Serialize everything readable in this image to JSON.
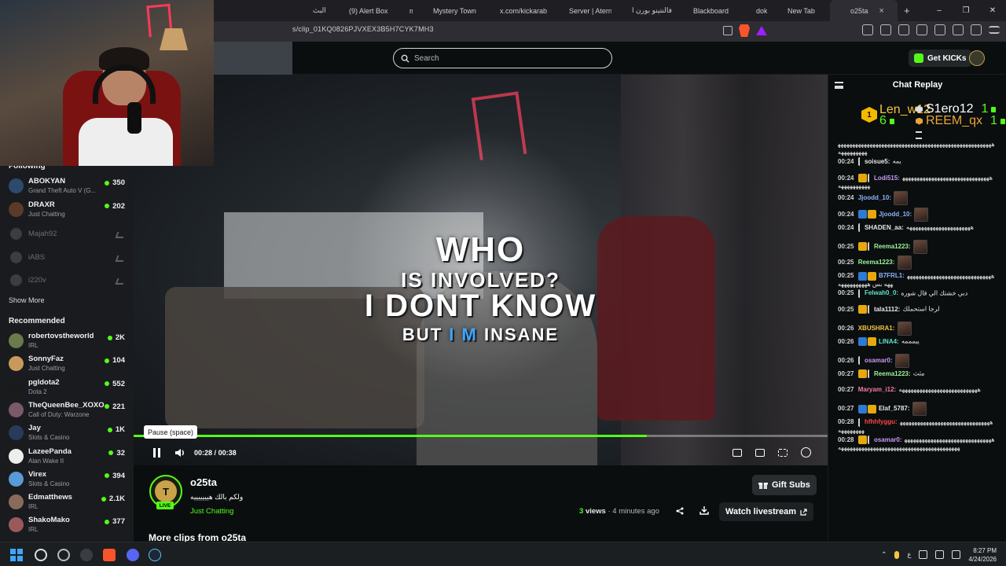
{
  "browser": {
    "tabs": [
      {
        "label": "البث",
        "color": "#555555"
      },
      {
        "label": "(9) Alert Box /",
        "color": "#3fbf9f"
      },
      {
        "label": "mt",
        "color": "#8a5a44"
      },
      {
        "label": "Mystery Town",
        "color": "#c0392b"
      },
      {
        "label": "x.com/kickarab",
        "color": "#111111"
      },
      {
        "label": "Server | Aterno",
        "color": "#2f6fd6"
      },
      {
        "label": "فالنتينو بورن ا",
        "color": "#f2f2f2"
      },
      {
        "label": "Blackboard",
        "color": "#f4b400"
      },
      {
        "label": "dokan",
        "color": "#b58a3c"
      },
      {
        "label": "New Tab",
        "color": "#dddddd"
      },
      {
        "label": "o25ta",
        "color": "#53fc18"
      }
    ],
    "url": "s/clip_01KQ0826PJVXEX3B5H7CYK7MH3",
    "window_controls": [
      "–",
      "❐",
      "✕"
    ],
    "new_tab": "+"
  },
  "header": {
    "search_placeholder": "Search",
    "get_kicks_label": "Get KICKs"
  },
  "sidebar": {
    "following_heading": "Following",
    "following": [
      {
        "name": "ABOKYAN",
        "sub": "Grand Theft Auto V (G...",
        "count": "350",
        "live": true,
        "avatar": "#2c4a6e"
      },
      {
        "name": "DRAXR",
        "sub": "Just Chatting",
        "count": "202",
        "live": true,
        "avatar": "#5a3b2a"
      },
      {
        "name": "Majah92",
        "sub": "",
        "count": "",
        "live": false,
        "avatar": "#3a3d41"
      },
      {
        "name": "iABS",
        "sub": "",
        "count": "",
        "live": false,
        "avatar": "#3a3d41"
      },
      {
        "name": "i220v",
        "sub": "",
        "count": "",
        "live": false,
        "avatar": "#3a3d41"
      }
    ],
    "show_more_label": "Show More",
    "recommended_heading": "Recommended",
    "recommended": [
      {
        "name": "robertovstheworld",
        "sub": "IRL",
        "count": "2K",
        "avatar": "#6a7a4a"
      },
      {
        "name": "SonnyFaz",
        "sub": "Just Chatting",
        "count": "104",
        "avatar": "#c89a5a"
      },
      {
        "name": "pgldota2",
        "sub": "Dota 2",
        "count": "552",
        "avatar": "#1a1a1a"
      },
      {
        "name": "TheQueenBee_XOXO",
        "sub": "Call of Duty: Warzone",
        "count": "221",
        "avatar": "#7a5a6a"
      },
      {
        "name": "Jay",
        "sub": "Slots & Casino",
        "count": "1K",
        "avatar": "#2a3a5a"
      },
      {
        "name": "LazeePanda",
        "sub": "Alan Wake II",
        "count": "32",
        "avatar": "#ededed"
      },
      {
        "name": "Virex",
        "sub": "Slots & Casino",
        "count": "394",
        "avatar": "#5a9ad6"
      },
      {
        "name": "Edmatthews",
        "sub": "IRL",
        "count": "2.1K",
        "avatar": "#8a6a5a"
      },
      {
        "name": "ShakoMako",
        "sub": "IRL",
        "count": "377",
        "avatar": "#9a5a5a"
      }
    ]
  },
  "video": {
    "caption_line1": "WHO",
    "caption_line2": "IS INVOLVED?",
    "caption_line3": "I DONT KNOW",
    "caption_line4_a": "BUT",
    "caption_line4_b": "I M",
    "caption_line4_c": "INSANE",
    "tooltip": "Pause (space)",
    "time_current": "00:28",
    "time_separator": "/",
    "time_total": "00:38",
    "progress_fraction": 0.74
  },
  "channel": {
    "avatar_letter": "T",
    "live_badge": "LIVE",
    "name": "o25ta",
    "title": "ولكم بالك هيييييييه",
    "category": "Just Chatting",
    "gift_subs_label": "Gift Subs",
    "views_count": "3",
    "views_label": "views",
    "views_time": "· 4 minutes ago",
    "watch_label": "Watch livestream",
    "more_clips_label": "More clips from o25ta"
  },
  "chat": {
    "title": "Chat Replay",
    "leaderboard": {
      "rank": "1",
      "first_name": "Len_w12",
      "first_count": "6",
      "second_name": "S1ero12",
      "second_count": "1",
      "third_name": "REEM_qx",
      "third_count": "1"
    },
    "messages": [
      {
        "time": "",
        "user": "",
        "color": "#e8e8e8",
        "text": "هههههههههههههههههههههههههههههههههههههههههههههههههههههههههههههههه"
      },
      {
        "time": "00:24",
        "user": "soisue5:",
        "color": "#e8e8e8",
        "text": "يمه"
      },
      {
        "time": "00:24",
        "user": "Lodi515:",
        "color": "#c79af5",
        "text": "هههههههههههههههههههههههههههههههههههههههههه"
      },
      {
        "time": "00:24",
        "user": "Jjoodd_10:",
        "color": "#8ab4f8",
        "text": ""
      },
      {
        "time": "00:24",
        "user": "Jjoodd_10:",
        "color": "#8ab4f8",
        "text": ""
      },
      {
        "time": "00:24",
        "user": "SHADEN_aa:",
        "color": "#e8e8e8",
        "text": "ههههههههههههههههههههههه"
      },
      {
        "time": "00:25",
        "user": "Reema1223:",
        "color": "#9af59a",
        "text": ""
      },
      {
        "time": "00:25",
        "user": "Reema1223:",
        "color": "#9af59a",
        "text": ""
      },
      {
        "time": "00:25",
        "user": "B7FRL1:",
        "color": "#8ab4f8",
        "text": "ههههههههههههههههههههههههههههههههه بس ههههههههههه"
      },
      {
        "time": "00:25",
        "user": "Felwah0_0:",
        "color": "#5ee0c9",
        "text": "دبي خشتك الي قال شوره"
      },
      {
        "time": "00:25",
        "user": "tala1112:",
        "color": "#e8e8e8",
        "text": "لرجا استحملك"
      },
      {
        "time": "00:26",
        "user": "XBUSHRA1:",
        "color": "#f5c542",
        "text": ""
      },
      {
        "time": "00:26",
        "user": "LINA4:",
        "color": "#5ee0c9",
        "text": "ييمممه"
      },
      {
        "time": "00:26",
        "user": "osamar0:",
        "color": "#c79af5",
        "text": ""
      },
      {
        "time": "00:27",
        "user": "Reema1223:",
        "color": "#9af59a",
        "text": "مثث"
      },
      {
        "time": "00:27",
        "user": "Maryam_i12:",
        "color": "#f57aa3",
        "text": "هههههههههههههههههههههههههههه"
      },
      {
        "time": "00:27",
        "user": "Elaf_5787:",
        "color": "#e8e8e8",
        "text": ""
      },
      {
        "time": "00:28",
        "user": "hfhhfyggu:",
        "color": "#ff4444",
        "text": "ههههههههههههههههههههههههههههههههههههههههه"
      },
      {
        "time": "00:28",
        "user": "osamar0:",
        "color": "#c79af5",
        "text": "ههههههههههههههههههههههههههههههههههههههههههههههههههههههههههههههههههههههههه"
      }
    ]
  },
  "taskbar": {
    "time": "8:27 PM",
    "date": "4/24/2026",
    "lang": "ع"
  }
}
